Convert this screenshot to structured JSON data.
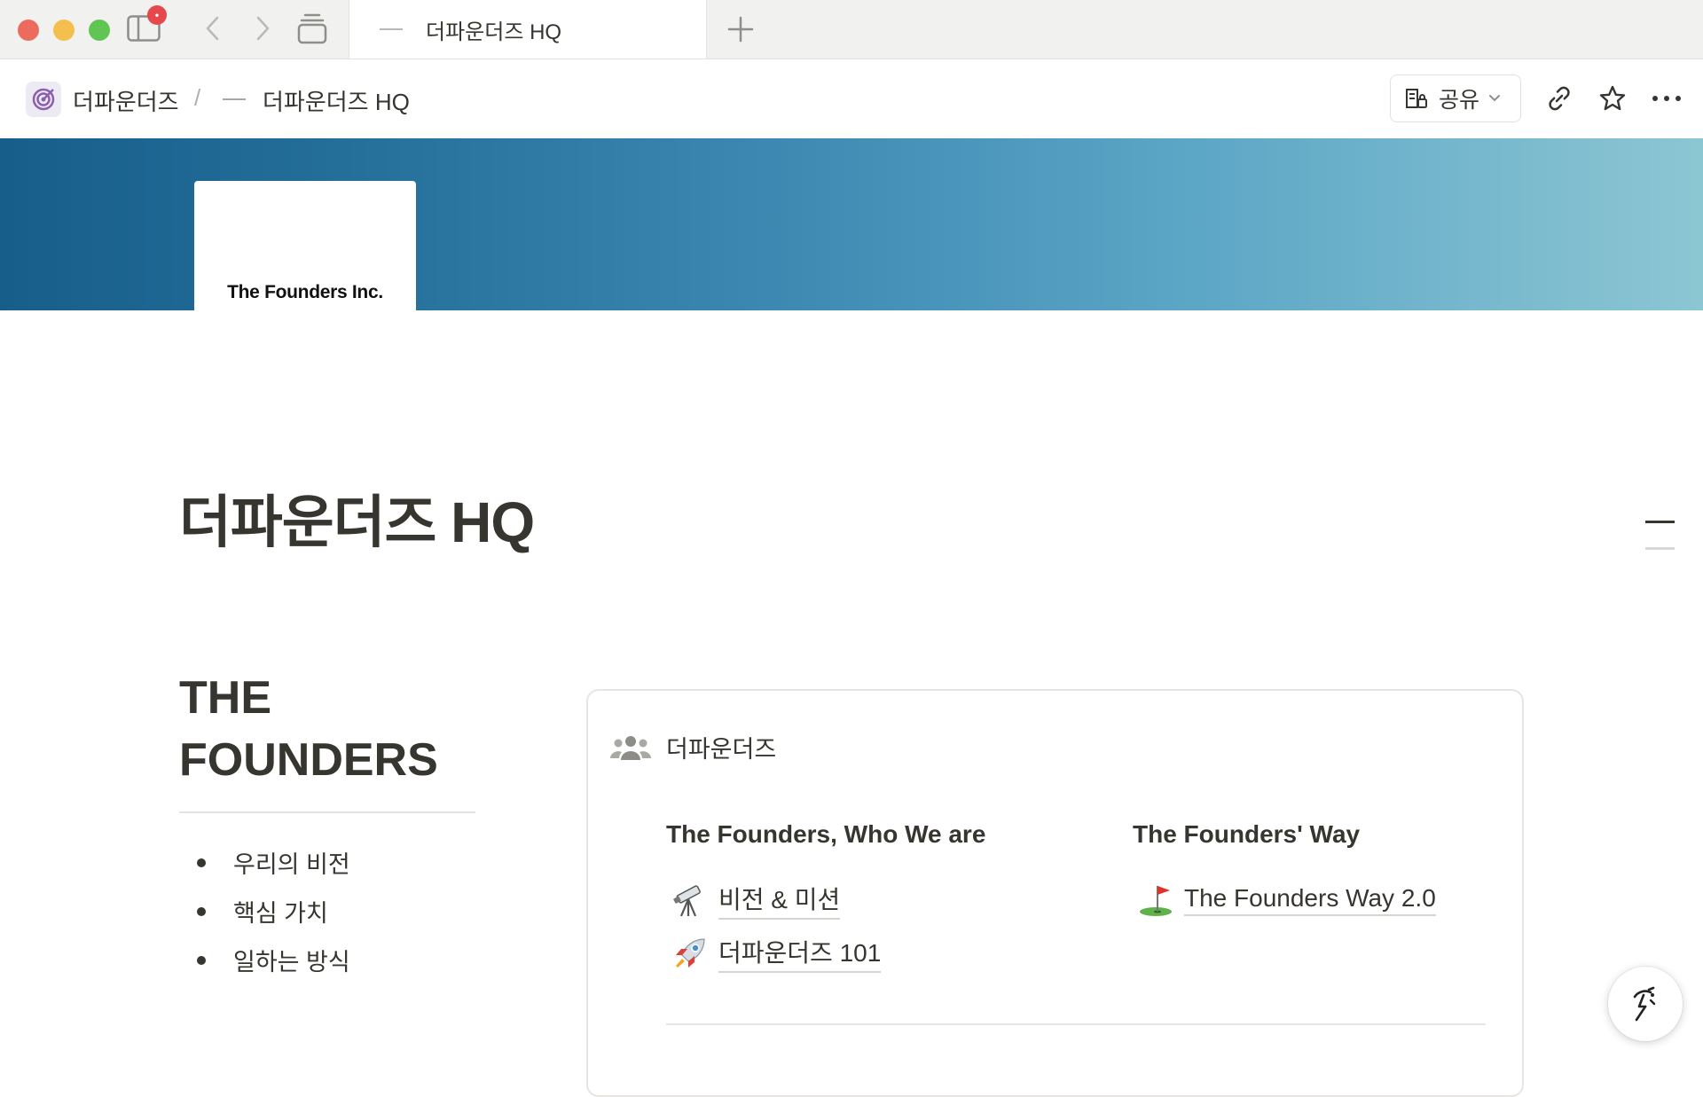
{
  "browser": {
    "notification_count": "•",
    "active_tab_title": "더파운더즈 HQ",
    "icons": {
      "sidebar": "sidebar-toggle-icon",
      "back": "chevron-left-icon",
      "forward": "chevron-right-icon",
      "tabs": "tab-overview-icon",
      "new_tab": "plus-icon"
    }
  },
  "topbar": {
    "workspace_name": "더파운더즈",
    "separator": "/",
    "page_name": "더파운더즈 HQ",
    "share_label": "공유",
    "icons": {
      "workspace": "target-icon",
      "share": "building-lock-icon",
      "link": "link-icon",
      "favorite": "star-icon",
      "more": "more-horizontal-icon"
    }
  },
  "cover": {
    "logo_text": "The Founders Inc.",
    "gradient_colors": [
      "#185e8b",
      "#3c88b2",
      "#8cc6d3"
    ]
  },
  "page": {
    "title": "더파운더즈 HQ",
    "sidebar": {
      "heading_line1": "THE",
      "heading_line2": "FOUNDERS",
      "items": [
        "우리의 비전",
        "핵심 가치",
        "일하는 방식"
      ]
    },
    "card": {
      "header_icon": "people-group-icon",
      "header_title": "더파운더즈",
      "column1_title": "The Founders, Who We are",
      "column2_title": "The Founders' Way",
      "links": [
        {
          "icon": "telescope-icon",
          "label": "비전 & 미션"
        },
        {
          "icon": "rocket-icon",
          "label": "더파운더즈 101"
        },
        {
          "icon": "golf-flag-icon",
          "label": "The Founders Way 2.0"
        }
      ]
    }
  },
  "help": {
    "icon": "notion-ai-face-icon"
  }
}
